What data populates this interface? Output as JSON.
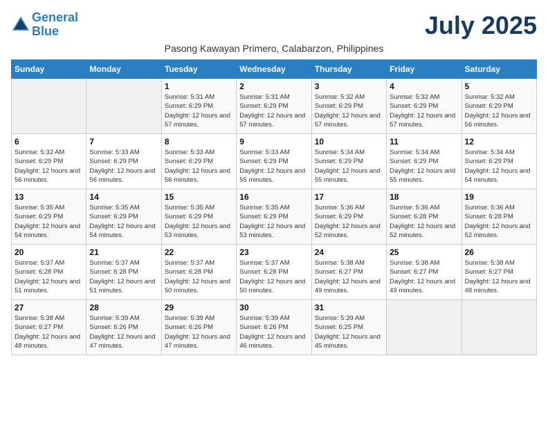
{
  "header": {
    "logo_line1": "General",
    "logo_line2": "Blue",
    "month_title": "July 2025",
    "subtitle": "Pasong Kawayan Primero, Calabarzon, Philippines"
  },
  "days_of_week": [
    "Sunday",
    "Monday",
    "Tuesday",
    "Wednesday",
    "Thursday",
    "Friday",
    "Saturday"
  ],
  "weeks": [
    [
      {
        "day": "",
        "info": ""
      },
      {
        "day": "",
        "info": ""
      },
      {
        "day": "1",
        "info": "Sunrise: 5:31 AM\nSunset: 6:29 PM\nDaylight: 12 hours and 57 minutes."
      },
      {
        "day": "2",
        "info": "Sunrise: 5:31 AM\nSunset: 6:29 PM\nDaylight: 12 hours and 57 minutes."
      },
      {
        "day": "3",
        "info": "Sunrise: 5:32 AM\nSunset: 6:29 PM\nDaylight: 12 hours and 57 minutes."
      },
      {
        "day": "4",
        "info": "Sunrise: 5:32 AM\nSunset: 6:29 PM\nDaylight: 12 hours and 57 minutes."
      },
      {
        "day": "5",
        "info": "Sunrise: 5:32 AM\nSunset: 6:29 PM\nDaylight: 12 hours and 56 minutes."
      }
    ],
    [
      {
        "day": "6",
        "info": "Sunrise: 5:32 AM\nSunset: 6:29 PM\nDaylight: 12 hours and 56 minutes."
      },
      {
        "day": "7",
        "info": "Sunrise: 5:33 AM\nSunset: 6:29 PM\nDaylight: 12 hours and 56 minutes."
      },
      {
        "day": "8",
        "info": "Sunrise: 5:33 AM\nSunset: 6:29 PM\nDaylight: 12 hours and 56 minutes."
      },
      {
        "day": "9",
        "info": "Sunrise: 5:33 AM\nSunset: 6:29 PM\nDaylight: 12 hours and 55 minutes."
      },
      {
        "day": "10",
        "info": "Sunrise: 5:34 AM\nSunset: 6:29 PM\nDaylight: 12 hours and 55 minutes."
      },
      {
        "day": "11",
        "info": "Sunrise: 5:34 AM\nSunset: 6:29 PM\nDaylight: 12 hours and 55 minutes."
      },
      {
        "day": "12",
        "info": "Sunrise: 5:34 AM\nSunset: 6:29 PM\nDaylight: 12 hours and 54 minutes."
      }
    ],
    [
      {
        "day": "13",
        "info": "Sunrise: 5:35 AM\nSunset: 6:29 PM\nDaylight: 12 hours and 54 minutes."
      },
      {
        "day": "14",
        "info": "Sunrise: 5:35 AM\nSunset: 6:29 PM\nDaylight: 12 hours and 54 minutes."
      },
      {
        "day": "15",
        "info": "Sunrise: 5:35 AM\nSunset: 6:29 PM\nDaylight: 12 hours and 53 minutes."
      },
      {
        "day": "16",
        "info": "Sunrise: 5:35 AM\nSunset: 6:29 PM\nDaylight: 12 hours and 53 minutes."
      },
      {
        "day": "17",
        "info": "Sunrise: 5:36 AM\nSunset: 6:29 PM\nDaylight: 12 hours and 52 minutes."
      },
      {
        "day": "18",
        "info": "Sunrise: 5:36 AM\nSunset: 6:28 PM\nDaylight: 12 hours and 52 minutes."
      },
      {
        "day": "19",
        "info": "Sunrise: 5:36 AM\nSunset: 6:28 PM\nDaylight: 12 hours and 52 minutes."
      }
    ],
    [
      {
        "day": "20",
        "info": "Sunrise: 5:37 AM\nSunset: 6:28 PM\nDaylight: 12 hours and 51 minutes."
      },
      {
        "day": "21",
        "info": "Sunrise: 5:37 AM\nSunset: 6:28 PM\nDaylight: 12 hours and 51 minutes."
      },
      {
        "day": "22",
        "info": "Sunrise: 5:37 AM\nSunset: 6:28 PM\nDaylight: 12 hours and 50 minutes."
      },
      {
        "day": "23",
        "info": "Sunrise: 5:37 AM\nSunset: 6:28 PM\nDaylight: 12 hours and 50 minutes."
      },
      {
        "day": "24",
        "info": "Sunrise: 5:38 AM\nSunset: 6:27 PM\nDaylight: 12 hours and 49 minutes."
      },
      {
        "day": "25",
        "info": "Sunrise: 5:38 AM\nSunset: 6:27 PM\nDaylight: 12 hours and 49 minutes."
      },
      {
        "day": "26",
        "info": "Sunrise: 5:38 AM\nSunset: 6:27 PM\nDaylight: 12 hours and 48 minutes."
      }
    ],
    [
      {
        "day": "27",
        "info": "Sunrise: 5:38 AM\nSunset: 6:27 PM\nDaylight: 12 hours and 48 minutes."
      },
      {
        "day": "28",
        "info": "Sunrise: 5:39 AM\nSunset: 6:26 PM\nDaylight: 12 hours and 47 minutes."
      },
      {
        "day": "29",
        "info": "Sunrise: 5:39 AM\nSunset: 6:26 PM\nDaylight: 12 hours and 47 minutes."
      },
      {
        "day": "30",
        "info": "Sunrise: 5:39 AM\nSunset: 6:26 PM\nDaylight: 12 hours and 46 minutes."
      },
      {
        "day": "31",
        "info": "Sunrise: 5:39 AM\nSunset: 6:25 PM\nDaylight: 12 hours and 45 minutes."
      },
      {
        "day": "",
        "info": ""
      },
      {
        "day": "",
        "info": ""
      }
    ]
  ]
}
